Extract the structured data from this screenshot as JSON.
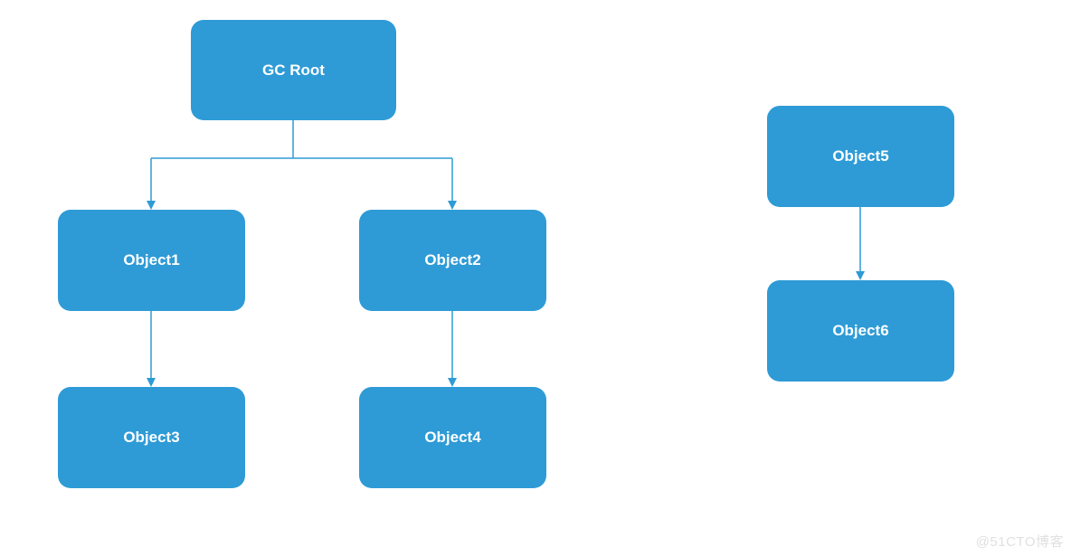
{
  "diagram": {
    "nodes": {
      "root": {
        "label": "GC Root"
      },
      "obj1": {
        "label": "Object1"
      },
      "obj2": {
        "label": "Object2"
      },
      "obj3": {
        "label": "Object3"
      },
      "obj4": {
        "label": "Object4"
      },
      "obj5": {
        "label": "Object5"
      },
      "obj6": {
        "label": "Object6"
      }
    },
    "edges": [
      {
        "from": "root",
        "to": "obj1"
      },
      {
        "from": "root",
        "to": "obj2"
      },
      {
        "from": "obj1",
        "to": "obj3"
      },
      {
        "from": "obj2",
        "to": "obj4"
      },
      {
        "from": "obj5",
        "to": "obj6"
      }
    ],
    "color": "#2E9BD6"
  },
  "watermark": "@51CTO博客"
}
